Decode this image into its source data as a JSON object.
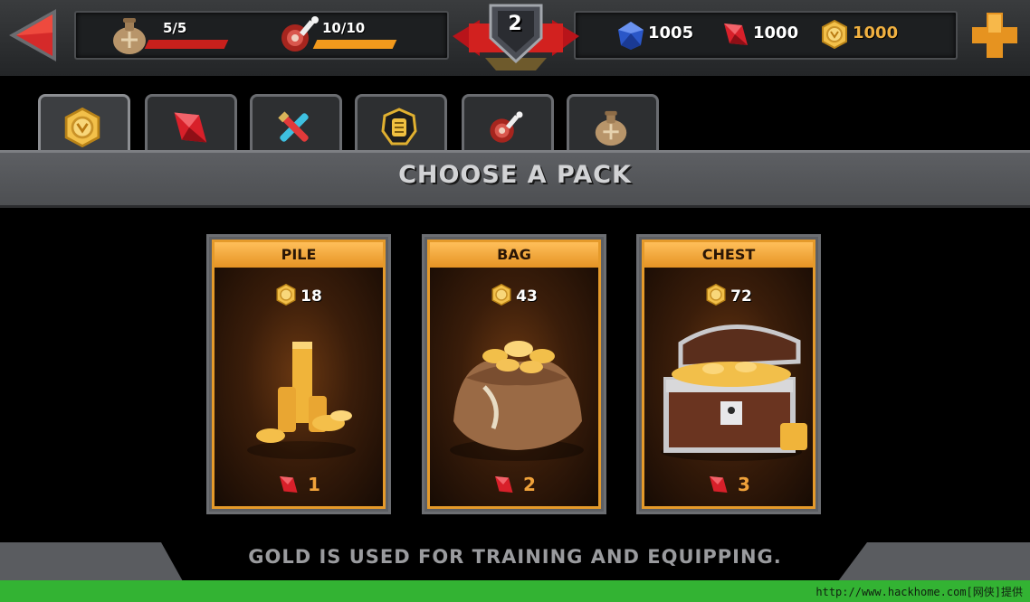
{
  "hud": {
    "stamina": {
      "value": "5/5",
      "fill": 1.0,
      "color": "#c8201c"
    },
    "food": {
      "value": "10/10",
      "fill": 1.0,
      "color": "#f39a1c"
    },
    "level": "2",
    "currencies": [
      {
        "name": "sapphire",
        "value": "1005",
        "color": "#ffffff"
      },
      {
        "name": "ruby",
        "value": "1000",
        "color": "#ffffff"
      },
      {
        "name": "gold",
        "value": "1000",
        "color": "#f0b040"
      }
    ]
  },
  "tabs": [
    {
      "id": "gold",
      "icon": "gold-coin-icon",
      "active": true
    },
    {
      "id": "ruby",
      "icon": "ruby-gem-icon",
      "active": false
    },
    {
      "id": "potions",
      "icon": "potion-vials-icon",
      "active": false
    },
    {
      "id": "token",
      "icon": "token-coin-icon",
      "active": false
    },
    {
      "id": "food",
      "icon": "meat-icon",
      "active": false
    },
    {
      "id": "stamina",
      "icon": "flask-icon",
      "active": false
    }
  ],
  "header": {
    "title": "CHOOSE A PACK"
  },
  "packs": [
    {
      "name": "PILE",
      "amount": "18",
      "price": "1",
      "art": "coin-pile"
    },
    {
      "name": "BAG",
      "amount": "43",
      "price": "2",
      "art": "coin-bag"
    },
    {
      "name": "CHEST",
      "amount": "72",
      "price": "3",
      "art": "treasure-chest"
    }
  ],
  "footer": {
    "text": "GOLD IS USED FOR TRAINING AND EQUIPPING."
  },
  "watermark": {
    "text": "http://www.hackhome.com[网侠]提供"
  },
  "colors": {
    "accent": "#e59a2a",
    "gold": "#f0b040",
    "ruby": "#d8202a",
    "sapphire": "#2a57c8"
  }
}
